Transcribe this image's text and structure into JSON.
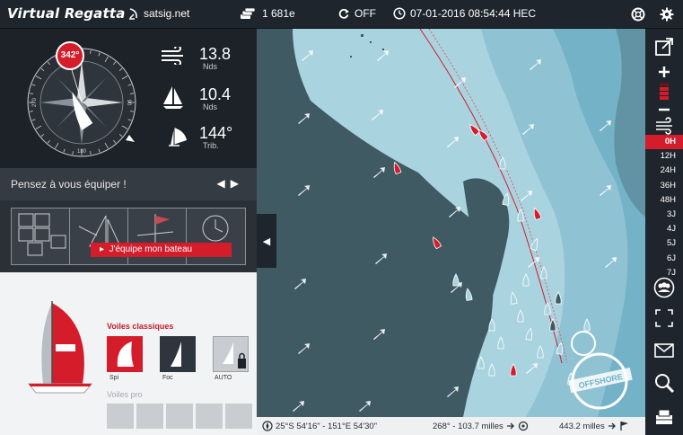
{
  "header": {
    "logo": "Virtual Regatta",
    "site": "satsig.net",
    "credits": "1 681e",
    "sync": "OFF",
    "datetime": "07-01-2016 08:54:44 HEC"
  },
  "compass": {
    "heading_badge": "342°",
    "ticks": [
      "0",
      "90",
      "180",
      "270"
    ]
  },
  "stats": {
    "wind_speed": "13.8",
    "wind_unit": "Nds",
    "boat_speed": "10.4",
    "boat_unit": "Nds",
    "twa": "144°",
    "twa_unit": "Trib."
  },
  "equip": {
    "prompt": "Pensez à vous équiper !",
    "button": "J'équipe mon bateau"
  },
  "sails": {
    "classic_title": "Voiles classiques",
    "items": [
      "Spi",
      "Foc",
      "AUTO"
    ],
    "pro_title": "Voiles pro"
  },
  "forecast": {
    "hours": [
      "0H",
      "12H",
      "24H",
      "36H",
      "48H",
      "3J",
      "4J",
      "5J",
      "6J",
      "7J"
    ],
    "active": "0H"
  },
  "status": {
    "position": "25°S 54'16\" - 151°E 54'30\"",
    "bearing": "268° - 103.7 milles",
    "distance": "443.2 milles"
  },
  "map": {
    "badge": "OFFSHORE"
  },
  "colors": {
    "accent_red": "#d41c2b",
    "land": "#3f5a63",
    "sea_shallow": "#a9d3df",
    "sea_deep": "#6fb0c4"
  }
}
